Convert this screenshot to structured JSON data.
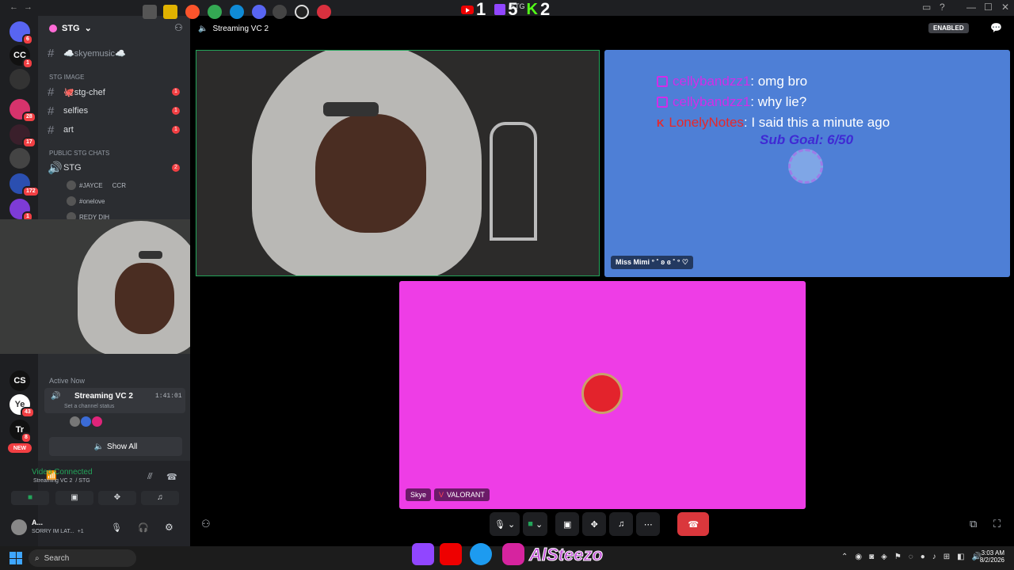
{
  "titlebar": {
    "title": "STG",
    "counts": [
      "1",
      "5",
      "2"
    ]
  },
  "server": {
    "name": "STG"
  },
  "servers": [
    {
      "label": "",
      "badge": "6",
      "color": "#5865f2"
    },
    {
      "label": "CC",
      "badge": "1",
      "color": "#111"
    },
    {
      "label": "",
      "badge": "",
      "color": "#333"
    },
    {
      "label": "",
      "badge": "28",
      "color": "#d6336c"
    },
    {
      "label": "",
      "badge": "17",
      "color": "#3a1f2b"
    },
    {
      "label": "",
      "badge": "",
      "color": "#444"
    },
    {
      "label": "",
      "badge": "172",
      "color": "#2b4fb0"
    },
    {
      "label": "",
      "badge": "1",
      "color": "#7d3bd6"
    }
  ],
  "servers_lower": [
    {
      "label": "CS",
      "badge": ""
    },
    {
      "label": "Ye",
      "badge": "43"
    },
    {
      "label": "Tr",
      "badge": "8"
    },
    {
      "label": "NEW",
      "badge": ""
    }
  ],
  "channels": {
    "skyemusic": "☁️skyemusic☁️",
    "cat_image": "STG IMAGE",
    "stg_chef": "🐙stg-chef",
    "selfies": "selfies",
    "art": "art",
    "cat_public": "PUBLIC STG CHATS",
    "stg_voice": "STG",
    "badges": [
      "1",
      "1",
      "1",
      "2"
    ],
    "voice_users": [
      "#JAYCE",
      "CCR",
      "#onelove",
      "REDY DIH"
    ]
  },
  "active_now": {
    "heading": "Active Now",
    "channel": "Streaming VC 2",
    "timer": "1:41:01",
    "status": "Set a channel status",
    "show_all": "Show All"
  },
  "voice_panel": {
    "status": "Video Connected",
    "where": "Streaming VC 2",
    "server": "/ STG"
  },
  "user": {
    "name": "A...",
    "status": "SORRY IM LAT...",
    "extra": "+1"
  },
  "stage": {
    "channel_title": "Streaming VC 2",
    "enabled": "ENABLED"
  },
  "chat": [
    {
      "user": "cellybandzz1",
      "msg": ": omg bro",
      "color": "#d12ee8"
    },
    {
      "user": "cellybandzz1",
      "msg": ": why lie?",
      "color": "#d12ee8"
    },
    {
      "user": "LonelyNotes",
      "msg": ": I said this a minute ago",
      "color": "#e8272a"
    }
  ],
  "sub_goal": "Sub Goal: 6/50",
  "tiles": {
    "b_name": "Miss Mimi °  ˚ ʚ ɞ ˚ °  ♡",
    "c_name": "Skye",
    "c_activity": "VALORANT"
  },
  "taskbar": {
    "search": "Search",
    "time": "3:03 AM",
    "date": "8/2/2026"
  },
  "socials": {
    "handle": "AlSteezo"
  }
}
